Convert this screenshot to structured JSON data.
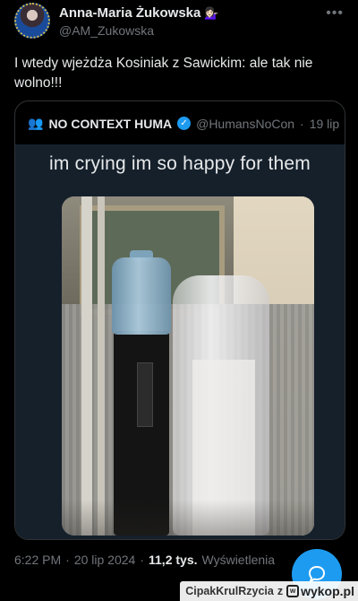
{
  "author": {
    "name": "Anna-Maria Żukowska",
    "emoji": "💁🏻‍♀️",
    "handle": "@AM_Zukowska"
  },
  "tweet": {
    "text": "I wtedy wjeżdża Kosiniak z Sawickim: ale tak nie wolno!!!"
  },
  "quoted": {
    "name": "NO CONTEXT HUMA",
    "handle": "@HumansNoCon",
    "dot": "·",
    "date": "19 lip",
    "caption": "im crying im so happy for them"
  },
  "meta": {
    "time": "6:22 PM",
    "sep1": "·",
    "date": "20 lip 2024",
    "sep2": "·",
    "views_count": "11,2 tys.",
    "views_label": "Wyświetlenia"
  },
  "watermark": {
    "user": "CipakKrulRzycia",
    "via": "z",
    "site": "wykop.pl"
  },
  "colors": {
    "background": "#000000",
    "accent": "#1d9bf0",
    "muted": "#71767b"
  }
}
